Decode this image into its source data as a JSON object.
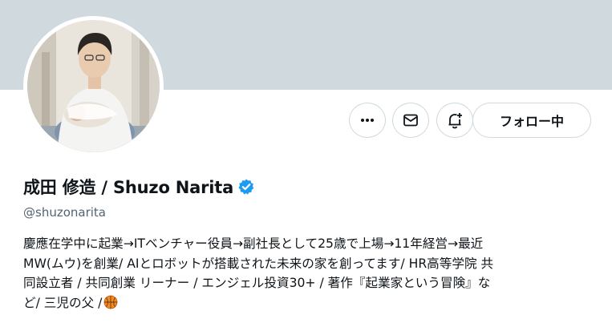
{
  "profile": {
    "display_name": "成田 修造 / Shuzo Narita",
    "handle": "@shuzonarita",
    "bio_lines": [
      "慶應在学中に起業→ITベンチャー役員→副社長として25歳で上場→11年経営→最近",
      "MW(ムウ)を創業/ AIとロボットが搭載された未来の家を創ってます/ HR高等学院 共",
      "同設立者 / 共同創業 リーナー / エンジェル投資30+ / 著作『起業家という冒険』な",
      "ど/ 三児の父 /"
    ],
    "bio_emoji": "basketball-icon",
    "verified": true
  },
  "actions": {
    "more_icon": "more-icon",
    "message_icon": "mail-icon",
    "notify_icon": "bell-plus-icon",
    "follow_label": "フォロー中"
  },
  "colors": {
    "banner": "#cfd9de",
    "verified_badge": "#1d9bf0",
    "handle_text": "#536471",
    "border": "#cfd9de"
  }
}
